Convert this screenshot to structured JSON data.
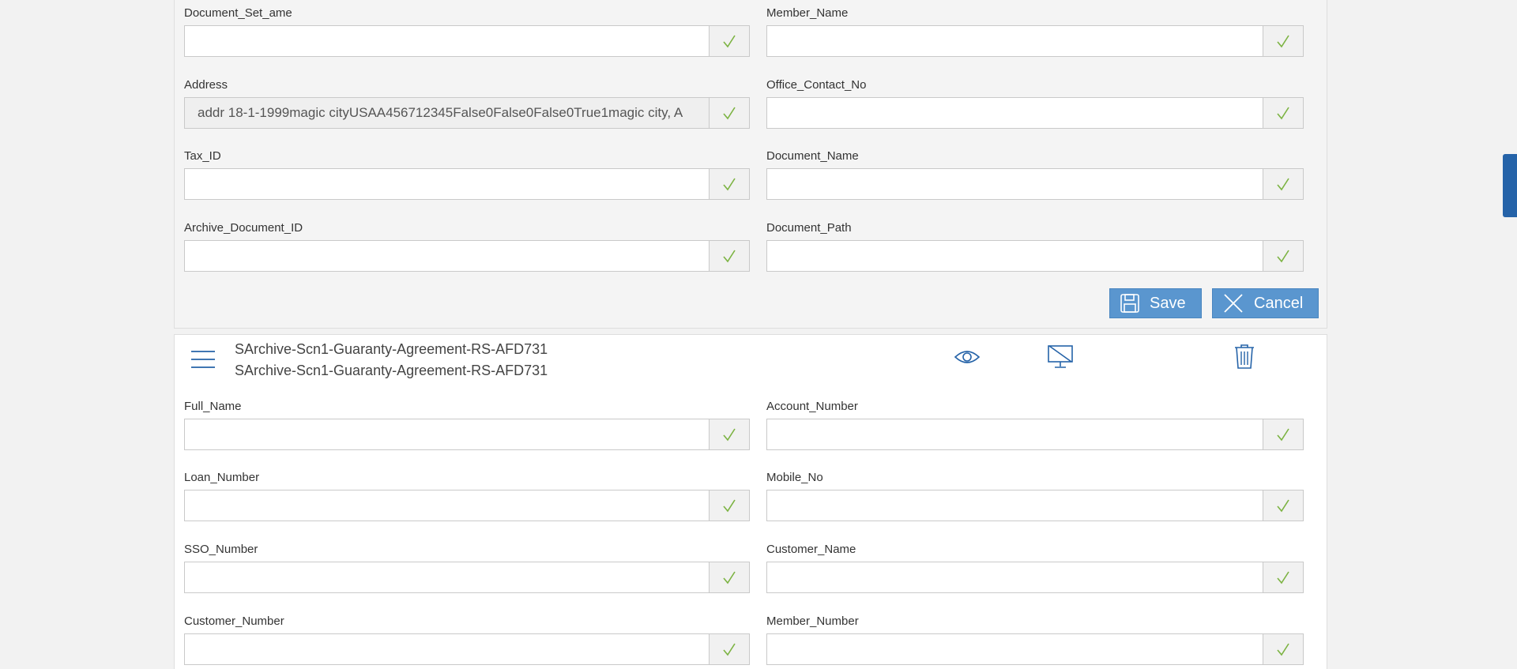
{
  "colors": {
    "page_bg": "#f2f2f2",
    "check": "#7cb342",
    "button_bg": "#5a96cf",
    "icon_blue": "#2563a8",
    "scroll_tab": "#2563a8"
  },
  "top_form": {
    "fields": [
      {
        "label": "Document_Set_ame",
        "value": ""
      },
      {
        "label": "Member_Name",
        "value": ""
      },
      {
        "label": "Address",
        "value": "addr 18-1-1999magic cityUSAA456712345False0False0False0True1magic city, A"
      },
      {
        "label": "Office_Contact_No",
        "value": ""
      },
      {
        "label": "Tax_ID",
        "value": ""
      },
      {
        "label": "Document_Name",
        "value": ""
      },
      {
        "label": "Archive_Document_ID",
        "value": ""
      },
      {
        "label": "Document_Path",
        "value": ""
      }
    ],
    "save_label": "Save",
    "cancel_label": "Cancel"
  },
  "document": {
    "title_line1": "SArchive-Scn1-Guaranty-Agreement-RS-AFD731",
    "title_line2": "SArchive-Scn1-Guaranty-Agreement-RS-AFD731",
    "icons": [
      "menu-icon",
      "eye-icon",
      "monitor-off-icon",
      "trash-icon"
    ],
    "fields": [
      {
        "label": "Full_Name",
        "value": ""
      },
      {
        "label": "Account_Number",
        "value": ""
      },
      {
        "label": "Loan_Number",
        "value": ""
      },
      {
        "label": "Mobile_No",
        "value": ""
      },
      {
        "label": "SSO_Number",
        "value": ""
      },
      {
        "label": "Customer_Name",
        "value": ""
      },
      {
        "label": "Customer_Number",
        "value": ""
      },
      {
        "label": "Member_Number",
        "value": ""
      }
    ]
  }
}
